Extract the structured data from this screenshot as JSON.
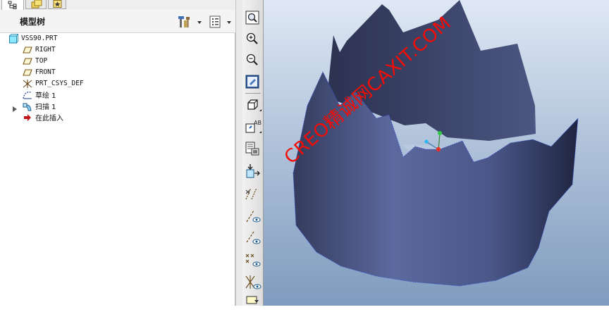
{
  "panel_tabs": [
    {
      "name": "model-tree-tab",
      "icon": "tree-icon",
      "active": true
    },
    {
      "name": "folder-browser-tab",
      "icon": "folder-icon",
      "active": false
    },
    {
      "name": "favorites-tab",
      "icon": "star-icon",
      "active": false
    }
  ],
  "panel": {
    "title": "模型树",
    "settings_icon": "tools-icon",
    "filter_icon": "show-list-icon"
  },
  "tree": {
    "items": [
      {
        "label": "VSS90.PRT",
        "icon": "part-icon"
      },
      {
        "label": "RIGHT",
        "icon": "datum-plane-icon"
      },
      {
        "label": "TOP",
        "icon": "datum-plane-icon"
      },
      {
        "label": "FRONT",
        "icon": "datum-plane-icon"
      },
      {
        "label": "PRT_CSYS_DEF",
        "icon": "csys-icon"
      },
      {
        "label": "草绘 1",
        "icon": "sketch-icon"
      },
      {
        "label": "扫描 1",
        "icon": "sweep-icon",
        "expandable": true
      },
      {
        "label": "在此插入",
        "icon": "insert-here-arrow-icon"
      }
    ]
  },
  "toolbar": {
    "buttons": [
      "zoom-fit-icon",
      "zoom-in-icon",
      "zoom-out-icon",
      "repaint-icon",
      "display-style-icon",
      "saved-views-icon",
      "layers-icon",
      "orient-icon",
      "datum-planes-toggle-icon",
      "datum-axes-toggle-icon",
      "datum-points-toggle-icon",
      "csys-toggle-icon",
      "annotations-toggle-icon",
      "spin-center-icon"
    ]
  },
  "viewport": {
    "watermark": "CREO精诚网CAXIT.COM",
    "model_color": "#4c5a8c"
  }
}
